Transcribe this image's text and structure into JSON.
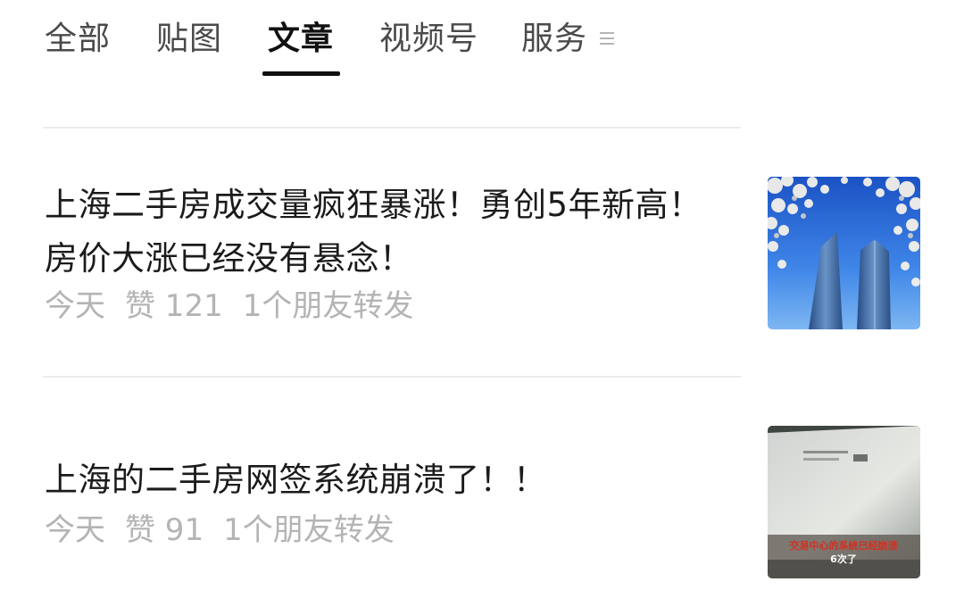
{
  "tabs": [
    {
      "label": "全部",
      "active": false
    },
    {
      "label": "贴图",
      "active": false
    },
    {
      "label": "文章",
      "active": true
    },
    {
      "label": "视频号",
      "active": false
    },
    {
      "label": "服务",
      "active": false
    }
  ],
  "more_icon": "hamburger-menu-icon",
  "articles": [
    {
      "title": "上海二手房成交量疯狂暴涨！勇创5年新高！房价大涨已经没有悬念！",
      "date": "今天",
      "likes": "赞 121",
      "shares": "1个朋友转发",
      "thumbnail": "skyscrapers-with-magnolia-blossoms"
    },
    {
      "title": "上海的二手房网签系统崩溃了！！",
      "date": "今天",
      "likes": "赞 91",
      "shares": "1个朋友转发",
      "thumbnail": "laptop-screen-photo",
      "thumbnail_caption_line1": "交易中心的系统已经崩溃",
      "thumbnail_caption_line2": "6次了"
    }
  ],
  "colors": {
    "active_tab": "#111111",
    "inactive_tab": "#4a4a4a",
    "meta_text": "#b4b4b4",
    "divider": "#ececec"
  }
}
